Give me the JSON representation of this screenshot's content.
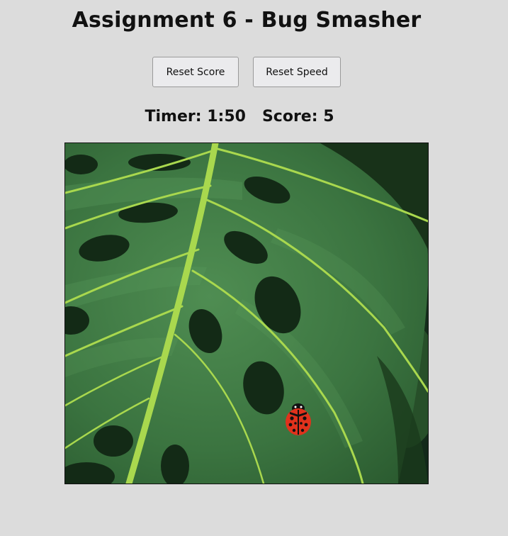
{
  "page": {
    "title": "Assignment 6 - Bug Smasher"
  },
  "controls": {
    "reset_score_label": "Reset Score",
    "reset_speed_label": "Reset Speed"
  },
  "stats": {
    "timer_label": "Timer:",
    "timer_value": "1:50",
    "score_label": "Score:",
    "score_value": "5"
  },
  "game": {
    "background": "monstera-leaf-image",
    "bug": "ladybug-icon"
  },
  "colors": {
    "page_background": "#dcdcdc",
    "leaf_green": "#3f7a46",
    "vein_green": "#a9d84e",
    "ladybug_red": "#e0321c"
  }
}
